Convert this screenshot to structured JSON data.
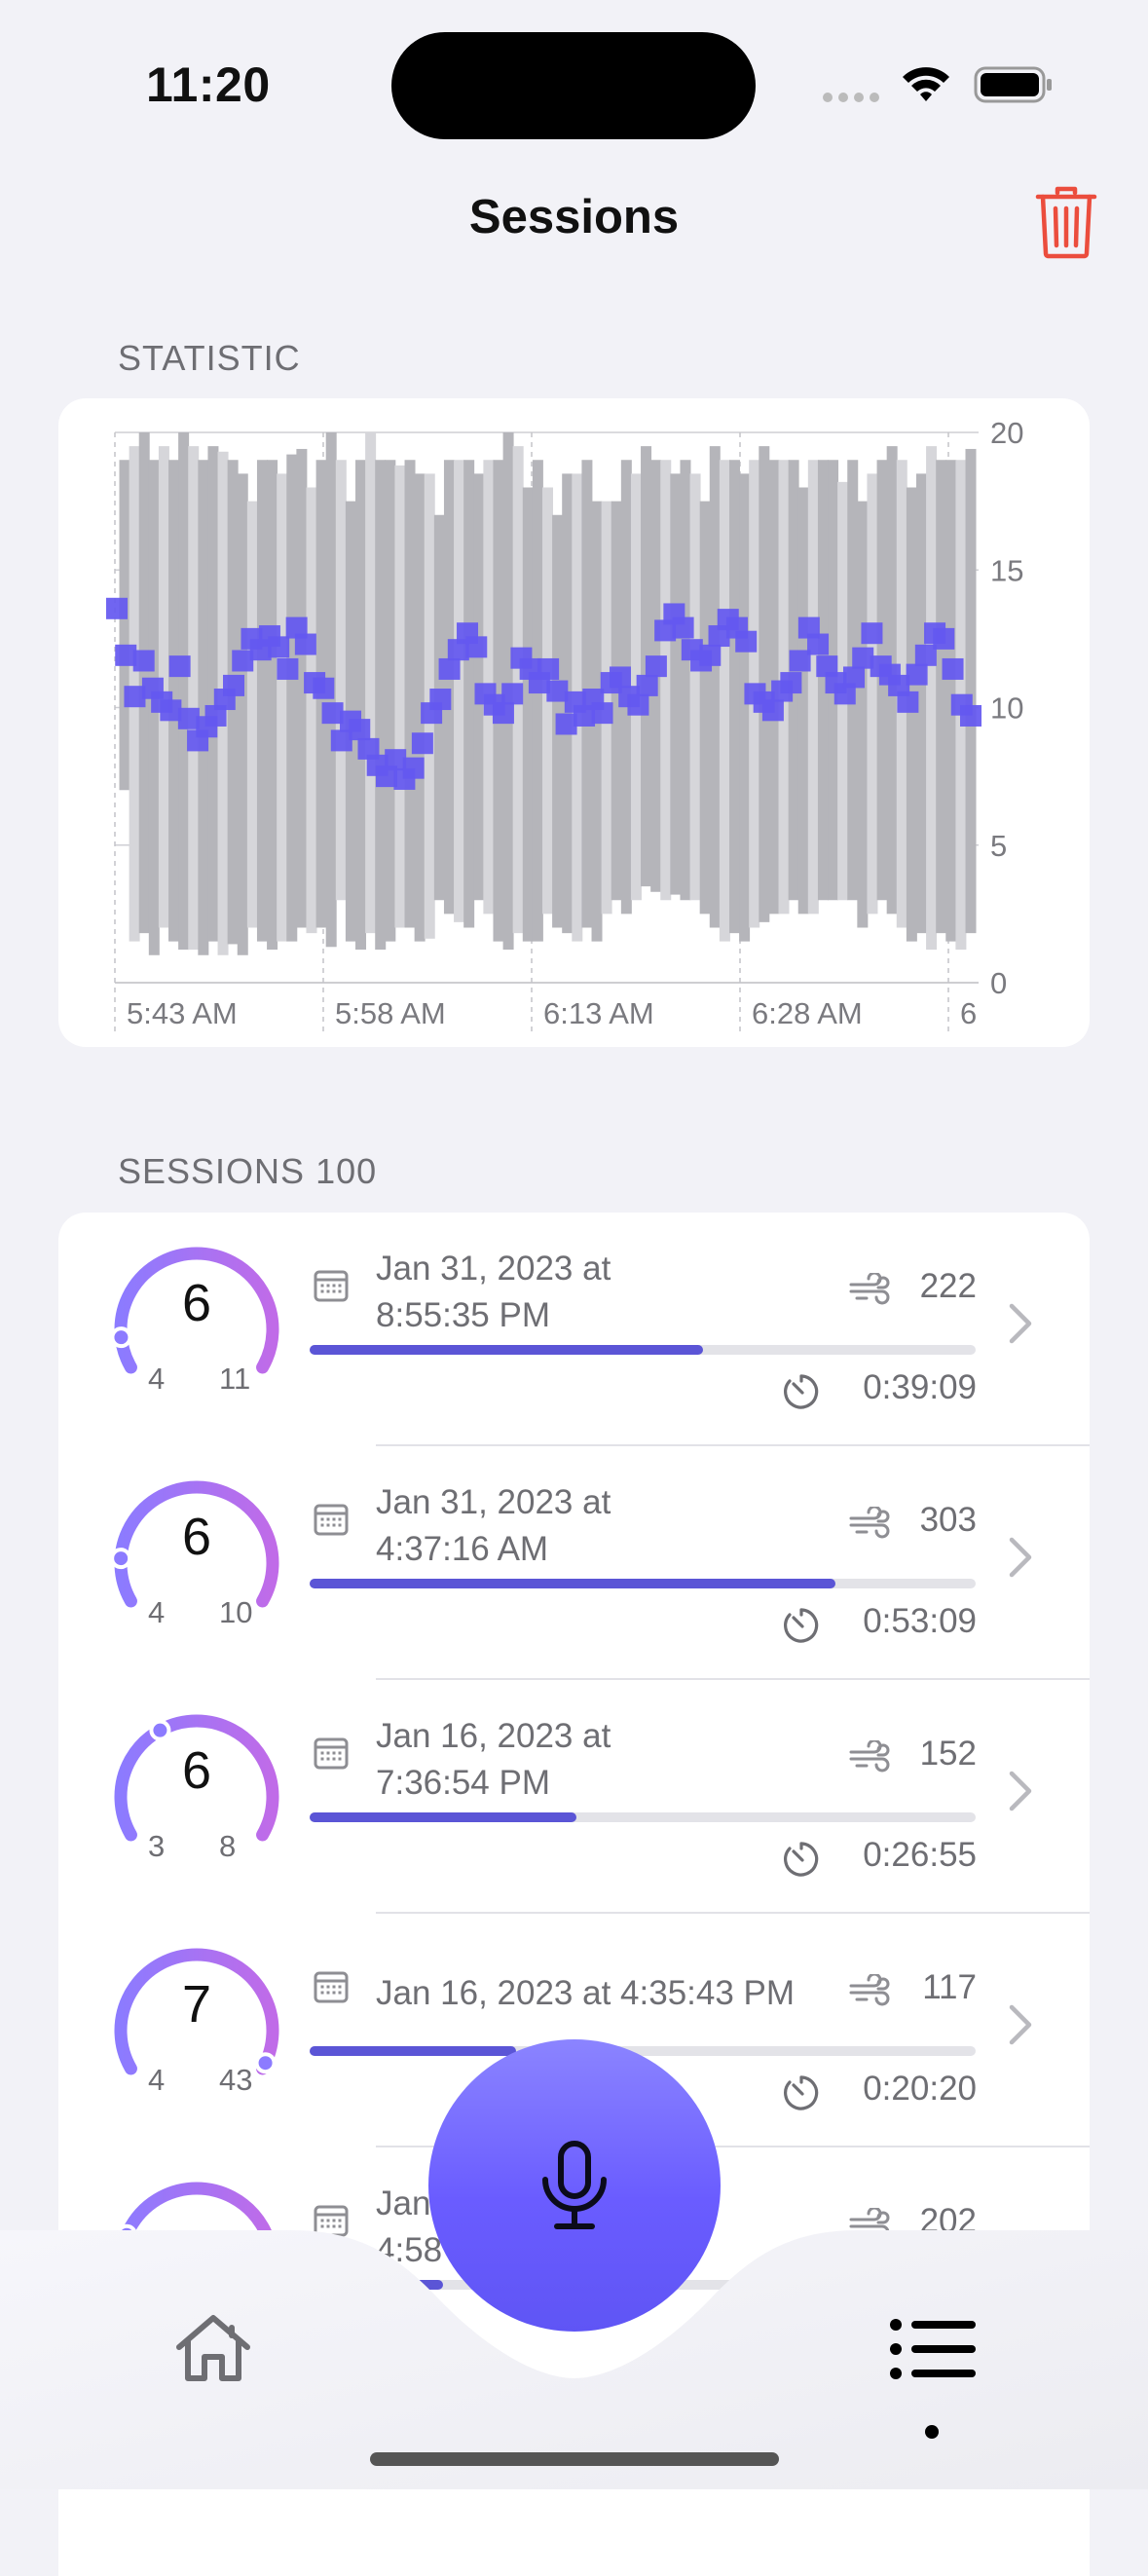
{
  "status_bar": {
    "time": "11:20"
  },
  "nav": {
    "title": "Sessions"
  },
  "statistic": {
    "section_label": "STATISTIC",
    "chart_data": {
      "type": "bar",
      "description_free": true,
      "y_ticks": [
        "20",
        "15",
        "10",
        "5",
        "0"
      ],
      "ylim": [
        0,
        20
      ],
      "x_tick_labels": [
        "5:43 AM",
        "5:58 AM",
        "6:13 AM",
        "6:28 AM",
        "6"
      ],
      "ranges": [
        [
          7,
          19
        ],
        [
          1.5,
          19.5
        ],
        [
          1.8,
          20
        ],
        [
          1,
          19
        ],
        [
          2,
          19.5
        ],
        [
          1.5,
          19
        ],
        [
          1.2,
          20
        ],
        [
          1.2,
          19.5
        ],
        [
          1,
          19
        ],
        [
          1.5,
          19.5
        ],
        [
          1,
          19.3
        ],
        [
          1.4,
          19
        ],
        [
          1,
          18.5
        ],
        [
          2,
          17.5
        ],
        [
          1.5,
          19
        ],
        [
          1.2,
          19
        ],
        [
          1.5,
          18.5
        ],
        [
          1.5,
          19.2
        ],
        [
          2,
          19.4
        ],
        [
          1.8,
          18
        ],
        [
          2,
          19
        ],
        [
          1.3,
          20
        ],
        [
          3,
          19
        ],
        [
          1.5,
          17.5
        ],
        [
          1.2,
          19
        ],
        [
          1.8,
          20
        ],
        [
          1.2,
          19
        ],
        [
          1.5,
          19
        ],
        [
          2,
          18.8
        ],
        [
          2,
          19
        ],
        [
          1.5,
          18.5
        ],
        [
          1.6,
          18.5
        ],
        [
          3,
          17
        ],
        [
          2.5,
          19
        ],
        [
          2.2,
          19
        ],
        [
          2,
          19
        ],
        [
          3,
          18.5
        ],
        [
          2.5,
          19
        ],
        [
          1.5,
          19
        ],
        [
          1.2,
          20
        ],
        [
          1.8,
          19.5
        ],
        [
          1.5,
          18
        ],
        [
          1.5,
          19
        ],
        [
          2.5,
          18
        ],
        [
          2,
          17
        ],
        [
          1.8,
          18.5
        ],
        [
          1.5,
          18.5
        ],
        [
          2,
          19
        ],
        [
          1.5,
          17.5
        ],
        [
          2.5,
          17.5
        ],
        [
          3,
          17.5
        ],
        [
          2.5,
          19
        ],
        [
          3,
          18.5
        ],
        [
          3.5,
          19.5
        ],
        [
          3.3,
          19
        ],
        [
          3,
          19
        ],
        [
          3.2,
          18.5
        ],
        [
          3,
          19
        ],
        [
          3,
          18.5
        ],
        [
          2.5,
          17.5
        ],
        [
          2,
          19.5
        ],
        [
          1.5,
          19
        ],
        [
          1.8,
          19
        ],
        [
          1.5,
          18.5
        ],
        [
          2,
          19
        ],
        [
          2.2,
          19.5
        ],
        [
          2.5,
          19
        ],
        [
          2.5,
          19
        ],
        [
          3,
          19
        ],
        [
          2.5,
          18
        ],
        [
          2.5,
          19
        ],
        [
          3,
          19
        ],
        [
          3,
          19
        ],
        [
          3,
          18.2
        ],
        [
          3,
          19
        ],
        [
          2,
          17.5
        ],
        [
          2.5,
          18.5
        ],
        [
          3,
          19
        ],
        [
          2.5,
          19.5
        ],
        [
          2,
          19
        ],
        [
          1.5,
          18
        ],
        [
          1.8,
          18.5
        ],
        [
          1.2,
          19.5
        ],
        [
          1.8,
          19
        ],
        [
          1.5,
          19
        ],
        [
          1.2,
          19
        ],
        [
          1.8,
          19.4
        ]
      ],
      "values": [
        13.6,
        11.9,
        10.4,
        11.7,
        10.7,
        10.2,
        9.9,
        11.5,
        9.6,
        8.8,
        9.3,
        9.7,
        10.3,
        10.8,
        11.7,
        12.5,
        12.1,
        12.6,
        12.2,
        11.4,
        12.9,
        12.3,
        10.9,
        10.7,
        9.8,
        8.8,
        9.5,
        9.2,
        8.5,
        7.9,
        7.5,
        8.1,
        7.4,
        7.8,
        8.7,
        9.8,
        10.3,
        11.4,
        12.1,
        12.7,
        12.2,
        10.5,
        10.1,
        9.8,
        10.5,
        11.8,
        11.4,
        10.9,
        11.4,
        10.6,
        9.4,
        10.2,
        9.7,
        10.3,
        9.8,
        10.9,
        11.1,
        10.4,
        10.1,
        10.8,
        11.5,
        12.8,
        13.4,
        12.9,
        12.1,
        11.7,
        11.9,
        12.6,
        13.2,
        12.9,
        12.4,
        10.5,
        10.2,
        9.9,
        10.6,
        10.9,
        11.7,
        12.9,
        12.3,
        11.5,
        10.9,
        10.5,
        11.1,
        11.8,
        12.7,
        11.5,
        11.2,
        10.8,
        10.2,
        11.2,
        11.9,
        12.7,
        12.5,
        11.4,
        10.1,
        9.7
      ]
    }
  },
  "sessions": {
    "section_label": "SESSIONS 100",
    "items": [
      {
        "avg": "6",
        "min": "4",
        "max": "11",
        "date": "Jan 31, 2023 at\n8:55:35 PM",
        "count": "222",
        "duration": "0:39:09",
        "progress": 0.59,
        "marker": 0.1,
        "single_line": false
      },
      {
        "avg": "6",
        "min": "4",
        "max": "10",
        "date": "Jan 31, 2023 at\n4:37:16 AM",
        "count": "303",
        "duration": "0:53:09",
        "progress": 0.79,
        "marker": 0.14,
        "single_line": false
      },
      {
        "avg": "6",
        "min": "3",
        "max": "8",
        "date": "Jan 16, 2023 at\n7:36:54 PM",
        "count": "152",
        "duration": "0:26:55",
        "progress": 0.4,
        "marker": 0.38,
        "single_line": false
      },
      {
        "avg": "7",
        "min": "4",
        "max": "43",
        "date": "Jan 16, 2023 at 4:35:43 PM",
        "count": "117",
        "duration": "0:20:20",
        "progress": 0.31,
        "marker": 0.98,
        "single_line": true
      },
      {
        "avg": "",
        "min": "",
        "max": "",
        "date": "Jan\n4:58",
        "count": "202",
        "duration": "",
        "progress": 0.2,
        "marker": 0.22,
        "single_line": false
      }
    ]
  },
  "tabs": [
    {
      "name": "home",
      "icon": "house-icon"
    },
    {
      "name": "list",
      "icon": "list-icon",
      "selected": true
    }
  ],
  "colors": {
    "accent": "#6A5CFF",
    "bar_fill": "#5B55D6",
    "trash": "#EB4D3D",
    "gauge_start": "#8C7BFF",
    "gauge_end": "#C06BE8"
  }
}
